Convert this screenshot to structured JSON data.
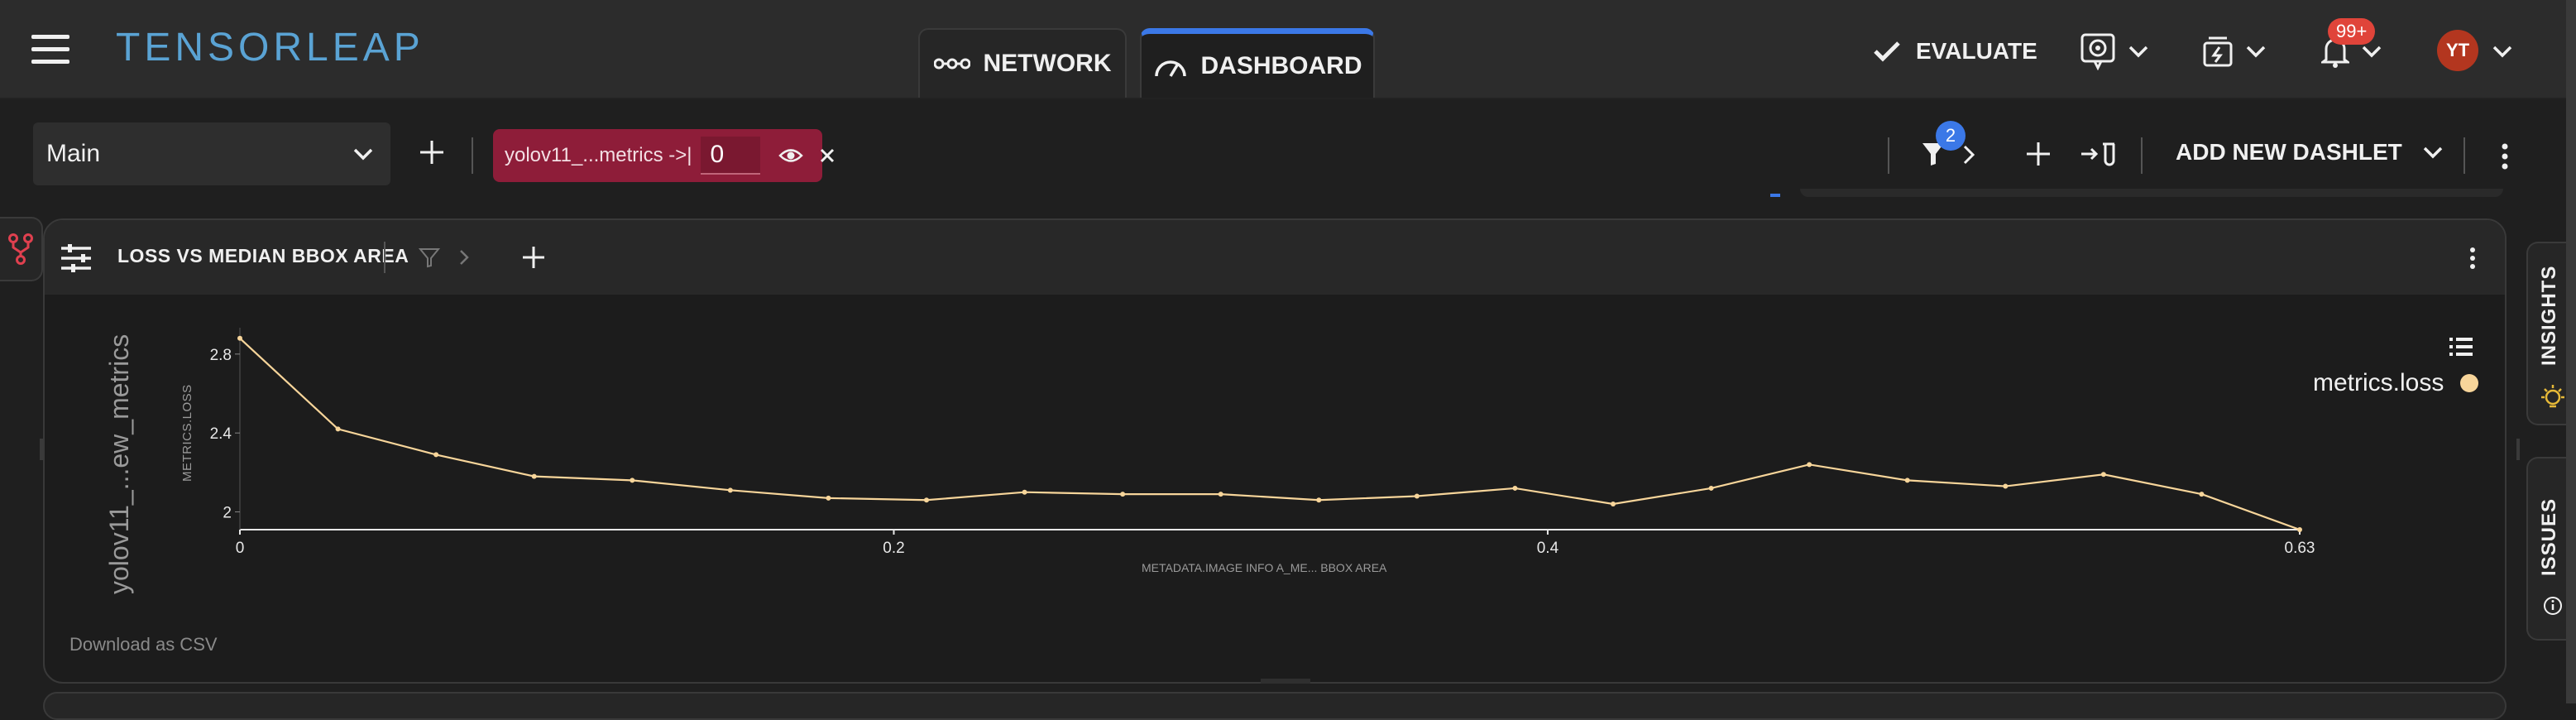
{
  "header": {
    "logo": "TENSORLEAP",
    "tabs": [
      {
        "label": "NETWORK",
        "active": false
      },
      {
        "label": "DASHBOARD",
        "active": true
      }
    ],
    "evaluate_label": "EVALUATE",
    "notifications_count": "99+",
    "avatar_initials": "YT"
  },
  "toolbar": {
    "dashboard_select": "Main",
    "filter_chip": {
      "label": "yolov11_...metrics ->|",
      "value": "0"
    },
    "filters_count": "2",
    "add_dashlet_label": "ADD NEW DASHLET"
  },
  "dashlet": {
    "title": "LOSS VS MEDIAN BBOX AREA",
    "download_label": "Download as CSV"
  },
  "chart_data": {
    "type": "line",
    "title": "",
    "xlabel": "METADATA.IMAGE INFO A_ME... BBOX AREA",
    "ylabel": "METRICS.LOSS",
    "ylabel_outer": "yolov11_...ew_metrics",
    "xlim": [
      0,
      0.63
    ],
    "ylim": [
      1.91,
      2.9
    ],
    "x_ticks": [
      "0",
      "0.2",
      "0.4",
      "0.63"
    ],
    "y_ticks": [
      "2",
      "2.4",
      "2.8"
    ],
    "legend_position": "top-right",
    "series": [
      {
        "name": "metrics.loss",
        "color": "#f7d59a",
        "x": [
          0,
          0.03,
          0.06,
          0.09,
          0.12,
          0.15,
          0.18,
          0.21,
          0.24,
          0.27,
          0.3,
          0.33,
          0.36,
          0.39,
          0.42,
          0.45,
          0.48,
          0.51,
          0.54,
          0.57,
          0.6,
          0.63
        ],
        "y": [
          2.88,
          2.42,
          2.29,
          2.18,
          2.16,
          2.11,
          2.07,
          2.06,
          2.1,
          2.09,
          2.09,
          2.06,
          2.08,
          2.12,
          2.04,
          2.12,
          2.24,
          2.16,
          2.13,
          2.19,
          2.09,
          1.91
        ]
      }
    ]
  },
  "side_panel": {
    "insights_label": "INSIGHTS",
    "issues_label": "ISSUES"
  }
}
